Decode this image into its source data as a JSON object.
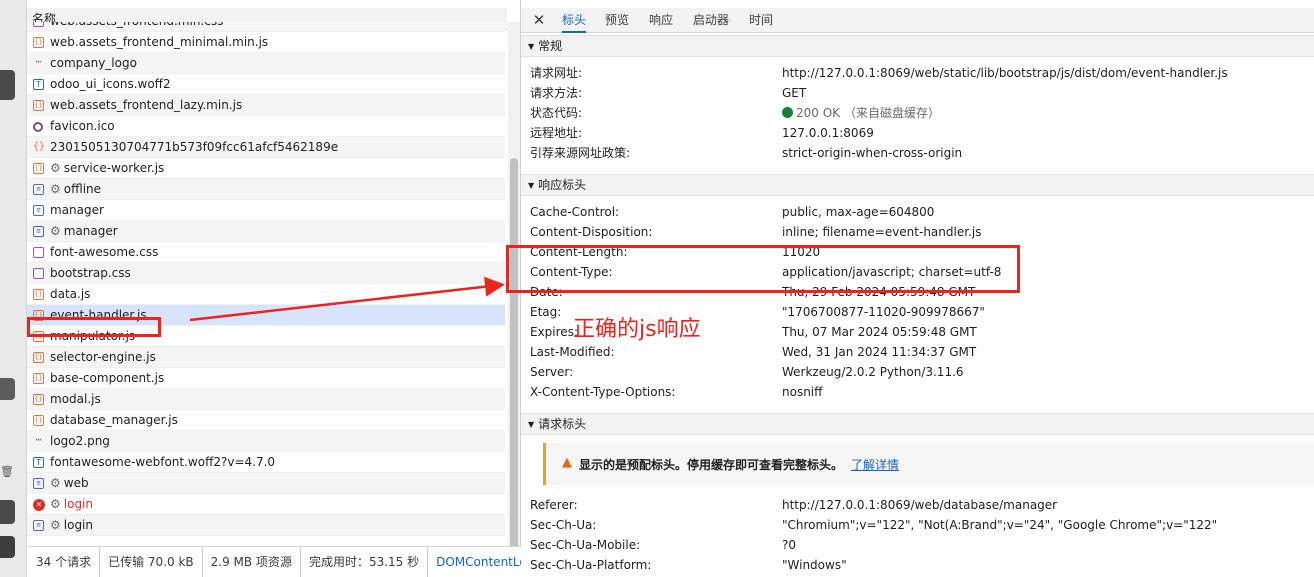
{
  "requests": {
    "column_header": "名称",
    "items": [
      {
        "name": "web.assets_frontend.min.css",
        "kind": "css"
      },
      {
        "name": "web.assets_frontend_minimal.min.js",
        "kind": "js"
      },
      {
        "name": "company_logo",
        "kind": "img"
      },
      {
        "name": "odoo_ui_icons.woff2",
        "kind": "font"
      },
      {
        "name": "web.assets_frontend_lazy.min.js",
        "kind": "js"
      },
      {
        "name": "favicon.ico",
        "kind": "fav"
      },
      {
        "name": "2301505130704771b573f09fcc61afcf5462189e",
        "kind": "json"
      },
      {
        "name": "service-worker.js",
        "kind": "js",
        "gear": true
      },
      {
        "name": "offline",
        "kind": "doc",
        "gear": true
      },
      {
        "name": "manager",
        "kind": "doc"
      },
      {
        "name": "manager",
        "kind": "doc",
        "gear": true
      },
      {
        "name": "font-awesome.css",
        "kind": "css"
      },
      {
        "name": "bootstrap.css",
        "kind": "css"
      },
      {
        "name": "data.js",
        "kind": "js"
      },
      {
        "name": "event-handler.js",
        "kind": "js",
        "selected": true
      },
      {
        "name": "manipulator.js",
        "kind": "js"
      },
      {
        "name": "selector-engine.js",
        "kind": "js"
      },
      {
        "name": "base-component.js",
        "kind": "js"
      },
      {
        "name": "modal.js",
        "kind": "js"
      },
      {
        "name": "database_manager.js",
        "kind": "js"
      },
      {
        "name": "logo2.png",
        "kind": "img"
      },
      {
        "name": "fontawesome-webfont.woff2?v=4.7.0",
        "kind": "font"
      },
      {
        "name": "web",
        "kind": "doc",
        "gear": true
      },
      {
        "name": "login",
        "kind": "err",
        "gear": true,
        "error": true
      },
      {
        "name": "login",
        "kind": "doc",
        "gear": true
      }
    ],
    "status": {
      "count": "34 个请求",
      "transferred": "已传输 70.0 kB",
      "resources": "2.9 MB 项资源",
      "finish": "完成用时：53.15 秒",
      "dcl": "DOMContentLoad"
    }
  },
  "detail": {
    "tabs": [
      "标头",
      "预览",
      "响应",
      "启动器",
      "时间"
    ],
    "active_tab": "标头",
    "general": {
      "title": "常规",
      "rows": [
        {
          "k": "请求网址:",
          "v": "http://127.0.0.1:8069/web/static/lib/bootstrap/js/dist/dom/event-handler.js"
        },
        {
          "k": "请求方法:",
          "v": "GET"
        },
        {
          "k": "状态代码:",
          "v": "200 OK",
          "note": "（来自磁盘缓存）"
        },
        {
          "k": "远程地址:",
          "v": "127.0.0.1:8069"
        },
        {
          "k": "引荐来源网址政策:",
          "v": "strict-origin-when-cross-origin"
        }
      ]
    },
    "response_headers": {
      "title": "响应标头",
      "rows": [
        {
          "k": "Cache-Control:",
          "v": "public, max-age=604800"
        },
        {
          "k": "Content-Disposition:",
          "v": "inline; filename=event-handler.js"
        },
        {
          "k": "Content-Length:",
          "v": "11020"
        },
        {
          "k": "Content-Type:",
          "v": "application/javascript; charset=utf-8"
        },
        {
          "k": "Date:",
          "v": "Thu, 29 Feb 2024 05:59:48 GMT"
        },
        {
          "k": "Etag:",
          "v": "\"1706700877-11020-909978667\""
        },
        {
          "k": "Expires:",
          "v": "Thu, 07 Mar 2024 05:59:48 GMT"
        },
        {
          "k": "Last-Modified:",
          "v": "Wed, 31 Jan 2024 11:34:37 GMT"
        },
        {
          "k": "Server:",
          "v": "Werkzeug/2.0.2 Python/3.11.6"
        },
        {
          "k": "X-Content-Type-Options:",
          "v": "nosniff"
        }
      ]
    },
    "request_headers": {
      "title": "请求标头",
      "warning": "显示的是预配标头。停用缓存即可查看完整标头。",
      "learn_more": "了解详情",
      "rows": [
        {
          "k": "Referer:",
          "v": "http://127.0.0.1:8069/web/database/manager"
        },
        {
          "k": "Sec-Ch-Ua:",
          "v": "\"Chromium\";v=\"122\", \"Not(A:Brand\";v=\"24\", \"Google Chrome\";v=\"122\""
        },
        {
          "k": "Sec-Ch-Ua-Mobile:",
          "v": "?0"
        },
        {
          "k": "Sec-Ch-Ua-Platform:",
          "v": "\"Windows\""
        }
      ]
    }
  },
  "annotation": {
    "text": "正确的js响应",
    "color": "#e8251f"
  },
  "colors": {
    "accent": "#1a62c4",
    "ok": "#188038",
    "error": "#d93025",
    "highlight": "#e8251f"
  }
}
